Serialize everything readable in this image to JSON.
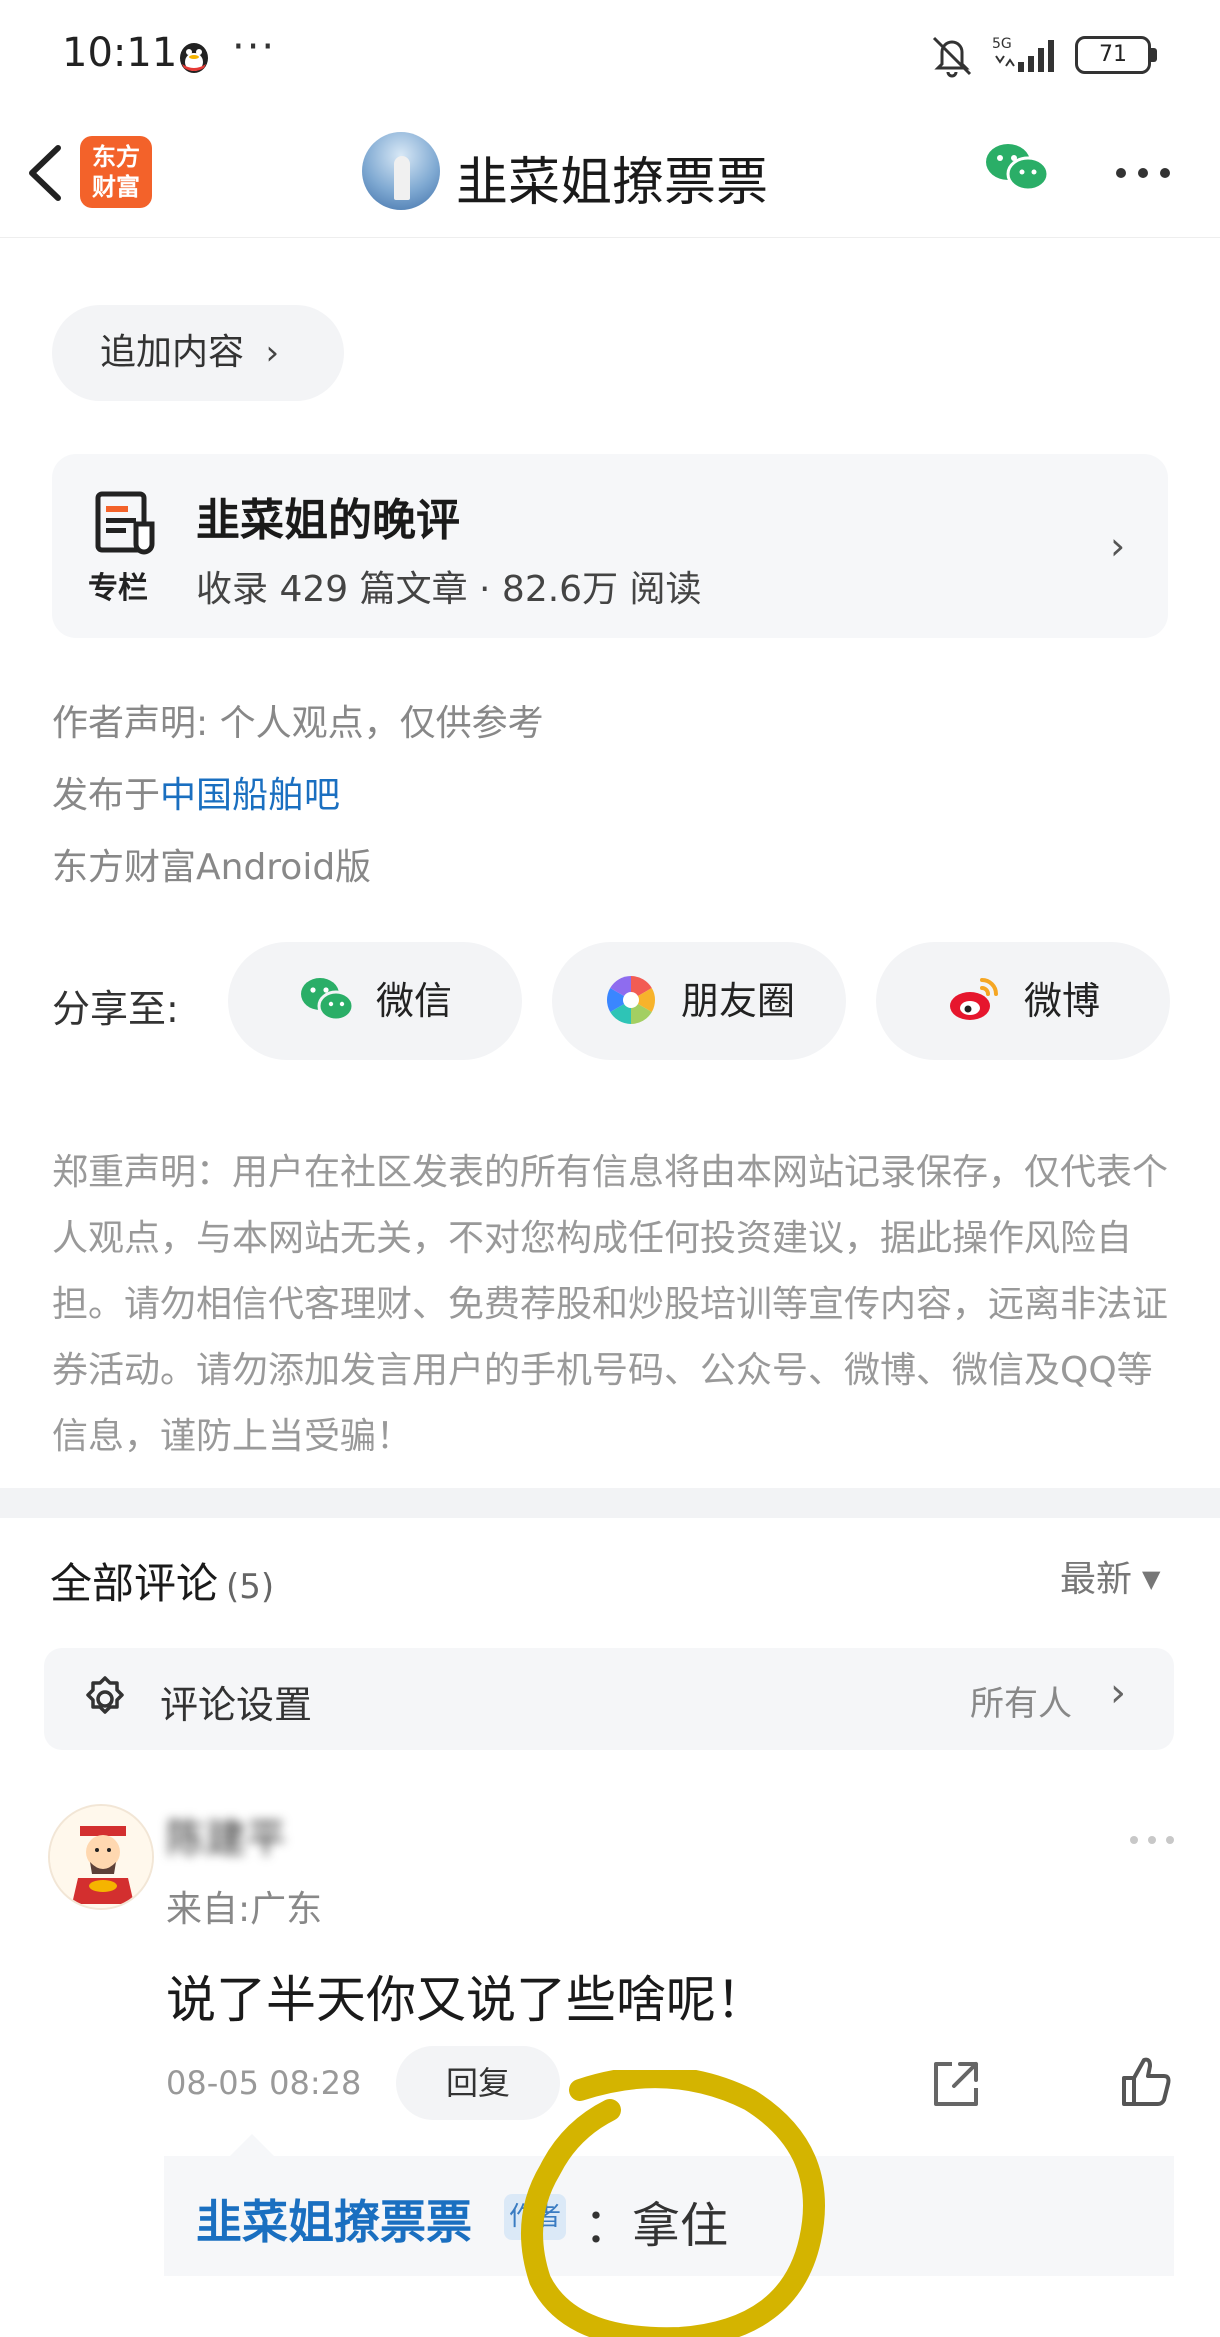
{
  "status_bar": {
    "time": "10:11",
    "dots": "···",
    "network": "5G",
    "battery": "71"
  },
  "nav": {
    "title": "韭菜姐撩票票",
    "app_logo_line1": "东方",
    "app_logo_line2": "财富"
  },
  "append_button": {
    "label": "追加内容",
    "chevron": "›"
  },
  "column": {
    "icon_label": "专栏",
    "title": "韭菜姐的晚评",
    "subtitle": "收录 429 篇文章 · 82.6万 阅读"
  },
  "meta": {
    "author_statement": "作者声明: 个人观点，仅供参考",
    "published_prefix": "发布于",
    "published_board": "中国船舶吧",
    "source": "东方财富Android版"
  },
  "share": {
    "label": "分享至:",
    "buttons": [
      {
        "label": "微信",
        "icon": "wechat-icon"
      },
      {
        "label": "朋友圈",
        "icon": "moments-icon"
      },
      {
        "label": "微博",
        "icon": "weibo-icon"
      }
    ]
  },
  "disclaimer": "郑重声明：用户在社区发表的所有信息将由本网站记录保存，仅代表个人观点，与本网站无关，不对您构成任何投资建议，据此操作风险自担。请勿相信代客理财、免费荐股和炒股培训等宣传内容，远离非法证券活动。请勿添加发言用户的手机号码、公众号、微博、微信及QQ等信息，谨防上当受骗！",
  "comments": {
    "title": "全部评论",
    "count": "(5)",
    "sort": "最新",
    "settings_label": "评论设置",
    "settings_value": "所有人",
    "items": [
      {
        "name": "陈建平",
        "from": "来自:广东",
        "text": "说了半天你又说了些啥呢！",
        "time": "08-05 08:28",
        "reply_label": "回复",
        "reply": {
          "author": "韭菜姐撩票票",
          "badge": "作者",
          "text": "：拿住"
        }
      }
    ]
  },
  "colors": {
    "accent_link": "#1a6fc0",
    "logo_orange": "#f3622a",
    "annotation": "#d4b400"
  }
}
